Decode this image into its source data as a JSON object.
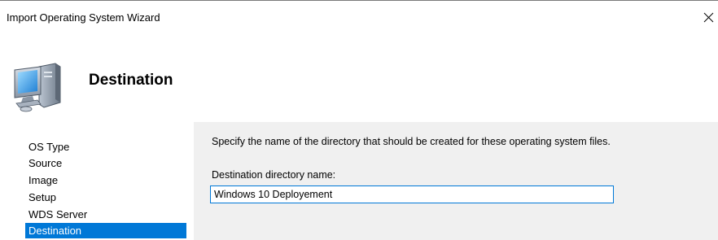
{
  "window": {
    "title": "Import Operating System Wizard",
    "close_icon": "close-icon"
  },
  "header": {
    "icon": "computer-icon",
    "title": "Destination"
  },
  "nav": {
    "items": [
      {
        "label": "OS Type",
        "active": false
      },
      {
        "label": "Source",
        "active": false
      },
      {
        "label": "Image",
        "active": false
      },
      {
        "label": "Setup",
        "active": false
      },
      {
        "label": "WDS Server",
        "active": false
      },
      {
        "label": "Destination",
        "active": true
      }
    ]
  },
  "main": {
    "instruction": "Specify the name of the directory that should be created for these operating system files.",
    "field_label": "Destination directory name:",
    "field_value": "Windows 10 Deployement"
  },
  "colors": {
    "selection": "#0078d7",
    "content_background": "#f0f0f0"
  }
}
